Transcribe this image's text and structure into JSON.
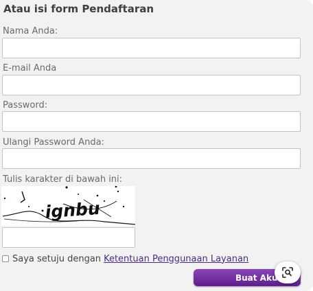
{
  "form": {
    "title": "Atau isi form Pendaftaran",
    "fields": [
      {
        "label": "Nama Anda:",
        "value": ""
      },
      {
        "label": "E-mail Anda",
        "value": ""
      },
      {
        "label": "Password:",
        "value": ""
      },
      {
        "label": "Ulangi Password Anda:",
        "value": ""
      }
    ],
    "captcha": {
      "label": "Tulis karakter di bawah ini:",
      "image_text": "ignbu",
      "value": ""
    },
    "agree": {
      "checked": false,
      "text": "Saya setuju dengan",
      "link": "Ketentuan Penggunaan Layanan"
    },
    "submit_label": "Buat Akun"
  },
  "overlay": {
    "icon": "visual-search-icon"
  },
  "colors": {
    "panel_bg": "#f2f2f2",
    "button": "#6a2a9a",
    "link": "#4b2a8a"
  }
}
